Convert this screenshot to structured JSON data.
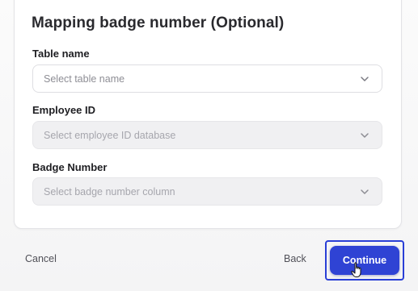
{
  "form": {
    "title": "Mapping badge number (Optional)",
    "fields": [
      {
        "label": "Table name",
        "placeholder": "Select table name",
        "disabled": false
      },
      {
        "label": "Employee ID",
        "placeholder": "Select employee ID database",
        "disabled": true
      },
      {
        "label": "Badge Number",
        "placeholder": "Select badge number column",
        "disabled": true
      }
    ]
  },
  "footer": {
    "cancel_label": "Cancel",
    "back_label": "Back",
    "continue_label": "Continue"
  },
  "colors": {
    "accent": "#2f43d4",
    "highlight_border": "#2a3fd6"
  },
  "icons": {
    "select_chevron": "chevron-down-icon",
    "cursor": "hand-pointer-icon"
  }
}
